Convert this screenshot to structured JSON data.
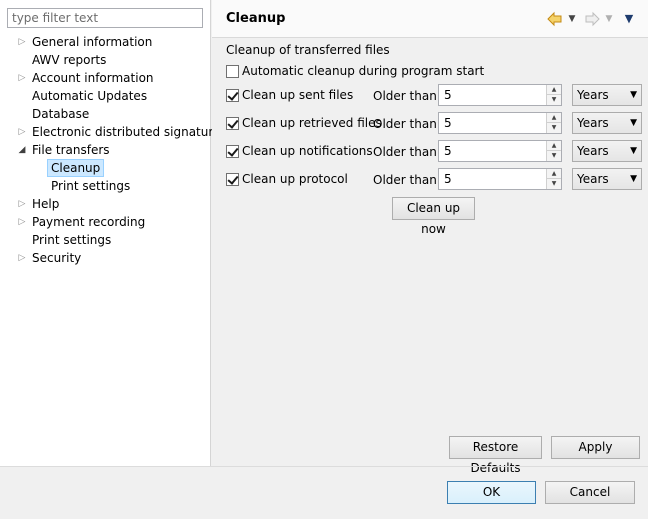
{
  "filter": {
    "placeholder": "type filter text"
  },
  "tree": {
    "items": [
      {
        "label": "General information",
        "arrow": "▷"
      },
      {
        "label": "AWV reports",
        "arrow": ""
      },
      {
        "label": "Account information",
        "arrow": "▷"
      },
      {
        "label": "Automatic Updates",
        "arrow": ""
      },
      {
        "label": "Database",
        "arrow": ""
      },
      {
        "label": "Electronic distributed signature",
        "arrow": "▷"
      },
      {
        "label": "File transfers",
        "arrow": "◢"
      },
      {
        "label": "Cleanup",
        "arrow": ""
      },
      {
        "label": "Print settings",
        "arrow": ""
      },
      {
        "label": "Help",
        "arrow": "▷"
      },
      {
        "label": "Payment recording",
        "arrow": "▷"
      },
      {
        "label": "Print settings",
        "arrow": ""
      },
      {
        "label": "Security",
        "arrow": "▷"
      }
    ]
  },
  "page": {
    "title": "Cleanup",
    "section_label": "Cleanup of transferred files",
    "auto_cleanup_label": "Automatic cleanup during program start",
    "rows": [
      {
        "label": "Clean up sent files",
        "older": "Older than",
        "value": "5",
        "unit": "Years"
      },
      {
        "label": "Clean up retrieved files",
        "older": "Older than",
        "value": "5",
        "unit": "Years"
      },
      {
        "label": "Clean up notifications",
        "older": "Older than",
        "value": "5",
        "unit": "Years"
      },
      {
        "label": "Clean up protocol",
        "older": "Older than",
        "value": "5",
        "unit": "Years"
      }
    ],
    "clean_now_label": "Clean up now",
    "restore_defaults_label": "Restore Defaults",
    "apply_label": "Apply"
  },
  "dialog": {
    "ok_label": "OK",
    "cancel_label": "Cancel"
  },
  "colors": {
    "selection": "#cce8ff",
    "back_arrow": "#e8a317",
    "forward_arrow": "#c8c8c8"
  }
}
